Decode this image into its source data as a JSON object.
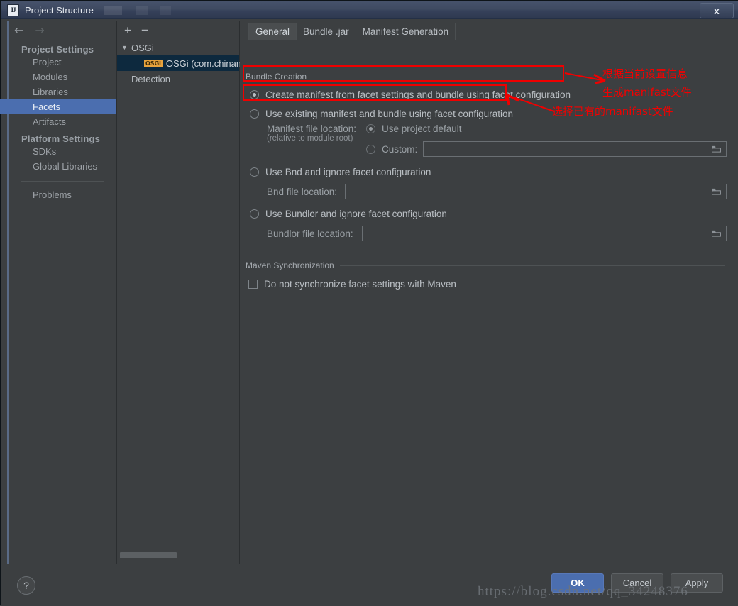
{
  "window": {
    "title": "Project Structure",
    "icon": "intellij-idea-icon",
    "icon_text": "IJ",
    "close_label": "x"
  },
  "sidebar": {
    "nav": {
      "back": "←",
      "forward": "→"
    },
    "groups": [
      {
        "label": "Project Settings",
        "items": [
          {
            "label": "Project",
            "selected": false
          },
          {
            "label": "Modules",
            "selected": false
          },
          {
            "label": "Libraries",
            "selected": false
          },
          {
            "label": "Facets",
            "selected": true
          },
          {
            "label": "Artifacts",
            "selected": false
          }
        ]
      },
      {
        "label": "Platform Settings",
        "items": [
          {
            "label": "SDKs",
            "selected": false
          },
          {
            "label": "Global Libraries",
            "selected": false
          }
        ]
      }
    ],
    "extra_items": [
      {
        "label": "Problems",
        "selected": false
      }
    ]
  },
  "tree": {
    "toolbar": {
      "add": "+",
      "remove": "−"
    },
    "rows": [
      {
        "label": "OSGi",
        "indent": 0,
        "expander": "▼",
        "badge": "",
        "selected": false
      },
      {
        "label": "OSGi (com.chinamol",
        "indent": 1,
        "expander": "",
        "badge": "OSGi",
        "selected": true
      },
      {
        "label": "Detection",
        "indent": 0,
        "expander": "",
        "badge": "",
        "selected": false
      }
    ]
  },
  "tabs": [
    {
      "label": "General",
      "active": true
    },
    {
      "label": "Bundle .jar",
      "active": false
    },
    {
      "label": "Manifest Generation",
      "active": false
    }
  ],
  "bundle_creation": {
    "group_label": "Bundle Creation",
    "option_create": {
      "label": "Create manifest from facet settings and bundle using facet configuration",
      "checked": true
    },
    "option_existing": {
      "label": "Use existing manifest and bundle using facet configuration",
      "checked": false
    },
    "manifest_location": {
      "label": "Manifest file location:",
      "sublabel": "(relative to module root)",
      "default_option": {
        "label": "Use project default",
        "checked": true
      },
      "custom_option": {
        "label": "Custom:",
        "checked": false
      },
      "custom_value": "",
      "browse_icon": "folder-icon"
    },
    "option_bnd": {
      "label": "Use Bnd and ignore facet configuration",
      "checked": false,
      "field_label": "Bnd file location:",
      "field_value": "",
      "browse_icon": "folder-icon"
    },
    "option_bundlor": {
      "label": "Use Bundlor and ignore facet configuration",
      "checked": false,
      "field_label": "Bundlor file location:",
      "field_value": "",
      "browse_icon": "folder-icon"
    }
  },
  "maven_sync": {
    "group_label": "Maven Synchronization",
    "checkbox": {
      "label": "Do not synchronize facet settings with Maven",
      "checked": false
    }
  },
  "annotations": {
    "color": "#f20000",
    "note1_line1": "根据当前设置信息",
    "note1_line2": "生成manifast文件",
    "note2": "选择已有的manifast文件"
  },
  "footer": {
    "help_label": "?",
    "ok_label": "OK",
    "cancel_label": "Cancel",
    "apply_label": "Apply"
  },
  "watermark": "https://blog.csdn.net/qq_34248376",
  "colors": {
    "accent": "#4b6eaf",
    "window_bg": "#3c3f41",
    "tree_selection": "#0d293e",
    "annotation_red": "#f20000",
    "badge_orange": "#e8a33d"
  }
}
